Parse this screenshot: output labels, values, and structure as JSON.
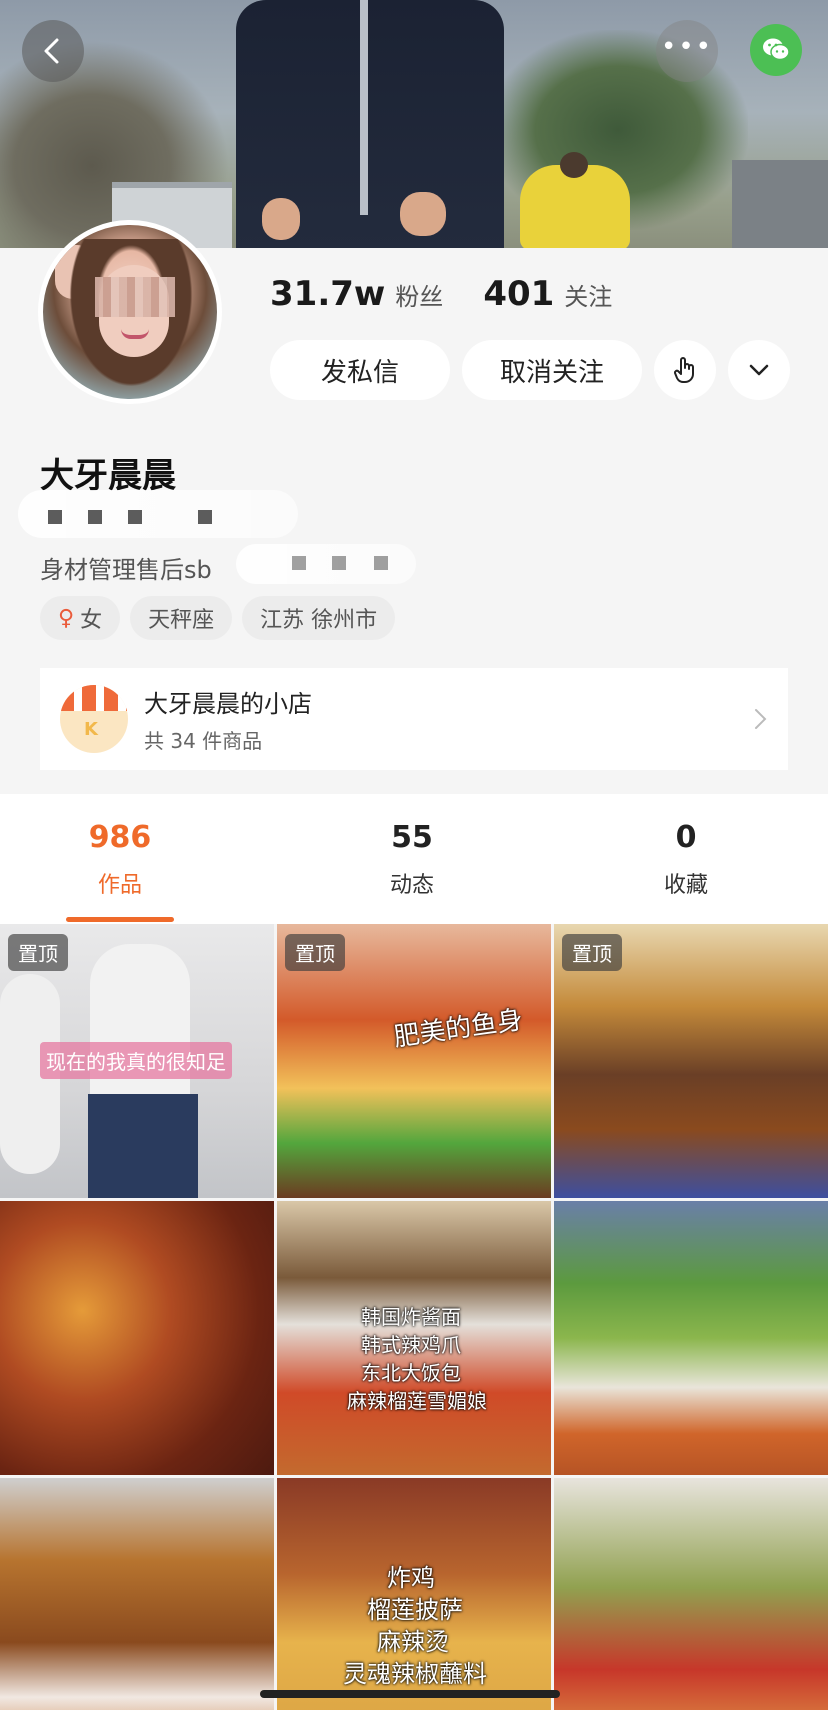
{
  "header": {
    "stats": [
      {
        "value": "31.7w",
        "label": "粉丝"
      },
      {
        "value": "401",
        "label": "关注"
      }
    ],
    "buttons": {
      "message": "发私信",
      "unfollow": "取消关注"
    },
    "name": "大牙晨晨",
    "bio": "身材管理售后sb",
    "tags": [
      {
        "icon": "female-icon",
        "label": "女"
      },
      {
        "label": "天秤座"
      },
      {
        "label": "江苏 徐州市"
      }
    ]
  },
  "shop": {
    "title": "大牙晨晨的小店",
    "subtitle": "共 34 件商品"
  },
  "tabs": [
    {
      "count": "986",
      "label": "作品",
      "active": true
    },
    {
      "count": "55",
      "label": "动态",
      "active": false
    },
    {
      "count": "0",
      "label": "收藏",
      "active": false
    }
  ],
  "grid": {
    "pinned_label": "置顶",
    "captions": {
      "video1": "现在的我真的很知足",
      "video2": "肥美的鱼身",
      "video5": [
        "韩国炸酱面",
        "韩式辣鸡爪",
        "东北大饭包",
        "麻辣榴莲雪媚娘"
      ],
      "video8": [
        "炸鸡",
        "榴莲披萨",
        "麻辣烫",
        "灵魂辣椒蘸料"
      ]
    }
  },
  "colors": {
    "accent": "#ef6a2a",
    "wechat": "#4cbf54"
  }
}
